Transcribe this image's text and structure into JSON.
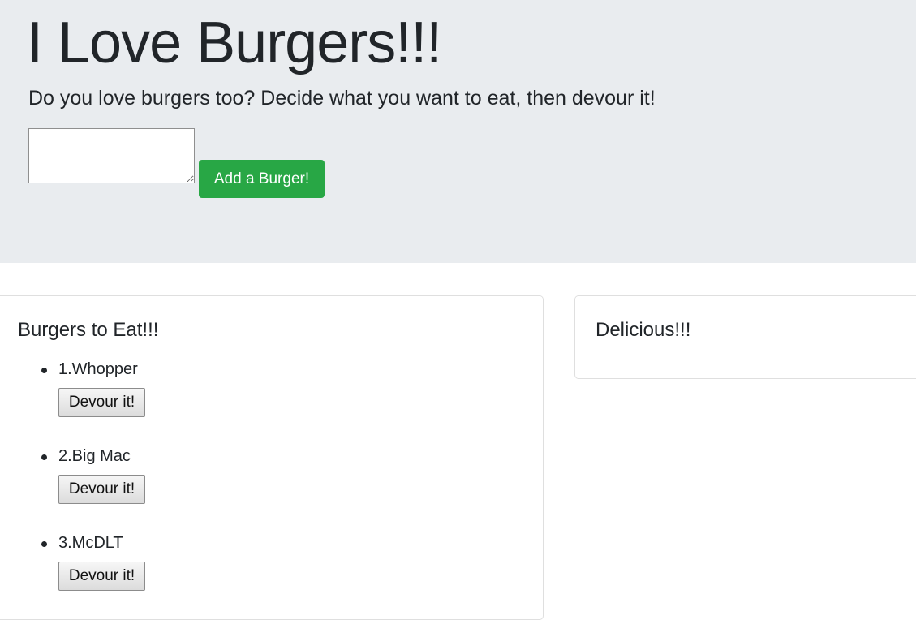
{
  "header": {
    "title": "I Love Burgers!!!",
    "lead": "Do you love burgers too? Decide what you want to eat, then devour it!",
    "burger_input_value": "",
    "add_button_label": "Add a Burger!"
  },
  "colors": {
    "jumbotron_bg": "#e9ecef",
    "add_button_bg": "#28a745",
    "card_border": "#dfdfdf"
  },
  "to_eat": {
    "title": "Burgers to Eat!!!",
    "items": [
      {
        "label": "1.Whopper",
        "button_label": "Devour it!"
      },
      {
        "label": "2.Big Mac",
        "button_label": "Devour it!"
      },
      {
        "label": "3.McDLT",
        "button_label": "Devour it!"
      }
    ]
  },
  "devoured": {
    "title": "Delicious!!!",
    "items": []
  }
}
